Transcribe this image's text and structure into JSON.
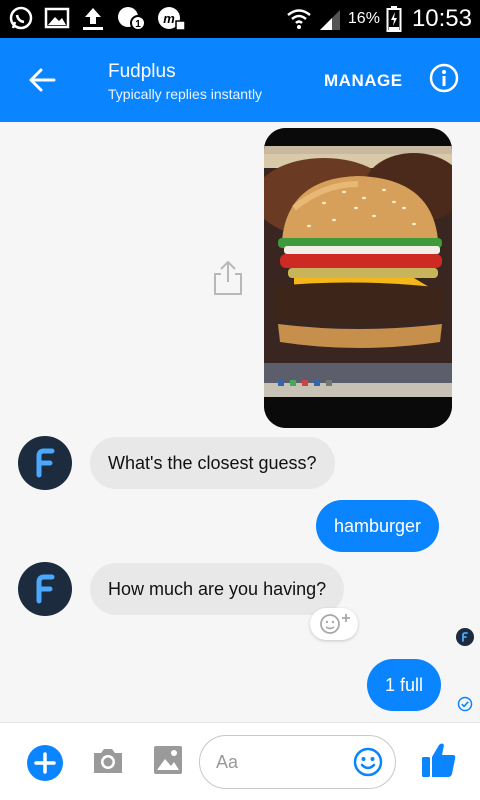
{
  "status_bar": {
    "battery_percent": "16%",
    "time": "10:53"
  },
  "header": {
    "title": "Fudplus",
    "subtitle": "Typically replies instantly",
    "manage_label": "MANAGE"
  },
  "messages": [
    {
      "from": "bot",
      "text": "What's the closest guess?"
    },
    {
      "from": "me",
      "text": "hamburger"
    },
    {
      "from": "bot",
      "text": "How much are you having?"
    },
    {
      "from": "me",
      "text": "1 full"
    }
  ],
  "composer": {
    "placeholder": "Aa"
  },
  "colors": {
    "brand_blue": "#0a84ff",
    "bubble_gray": "#e8e8e8",
    "avatar_navy": "#1c2b3e",
    "avatar_letter": "#4aa8ff"
  },
  "icons": [
    "whatsapp-icon",
    "gallery-icon",
    "upload-icon",
    "messenger-icon",
    "wifi-icon",
    "signal-icon",
    "battery-icon",
    "back-arrow-icon",
    "info-icon",
    "share-icon",
    "smiley-add-icon",
    "plus-icon",
    "camera-icon",
    "image-icon",
    "emoji-icon",
    "thumbs-up-icon",
    "check-icon"
  ]
}
